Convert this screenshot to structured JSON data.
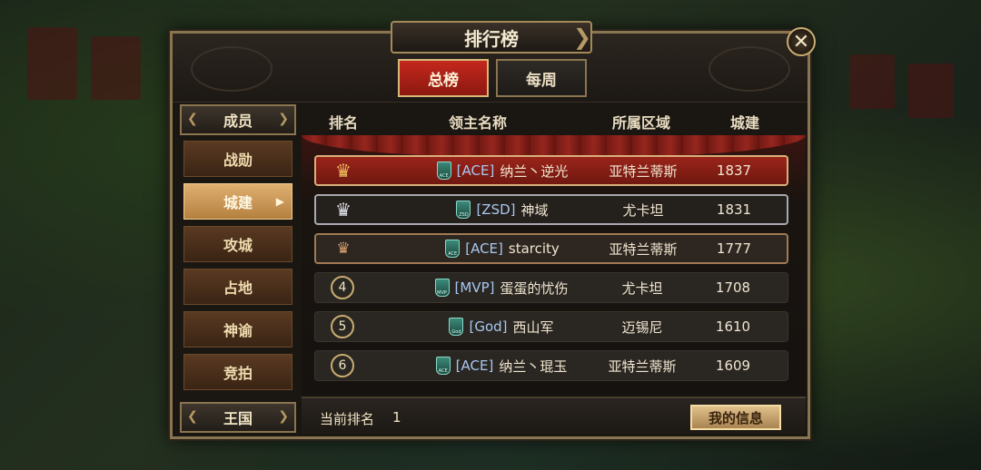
{
  "dialog": {
    "title": "排行榜",
    "close_symbol": "✕"
  },
  "tabs": [
    {
      "label": "总榜",
      "active": true
    },
    {
      "label": "每周",
      "active": false
    }
  ],
  "sidebar": {
    "header_top": "成员",
    "header_bottom": "王国",
    "items": [
      {
        "label": "战勋",
        "active": false
      },
      {
        "label": "城建",
        "active": true
      },
      {
        "label": "攻城",
        "active": false
      },
      {
        "label": "占地",
        "active": false
      },
      {
        "label": "神谕",
        "active": false
      },
      {
        "label": "竞拍",
        "active": false
      }
    ]
  },
  "table": {
    "columns": [
      "排名",
      "领主名称",
      "所属区域",
      "城建"
    ],
    "rows": [
      {
        "rank": "1",
        "badge": "ACE",
        "tag": "[ACE]",
        "name": "纳兰丶逆光",
        "region": "亚特兰蒂斯",
        "score": "1837"
      },
      {
        "rank": "2",
        "badge": "ZSD",
        "tag": "[ZSD]",
        "name": "神域",
        "region": "尤卡坦",
        "score": "1831"
      },
      {
        "rank": "3",
        "badge": "ACE",
        "tag": "[ACE]",
        "name": "starcity",
        "region": "亚特兰蒂斯",
        "score": "1777"
      },
      {
        "rank": "4",
        "badge": "MVP",
        "tag": "[MVP]",
        "name": "蛋蛋的忧伤",
        "region": "尤卡坦",
        "score": "1708"
      },
      {
        "rank": "5",
        "badge": "God",
        "tag": "[God]",
        "name": "西山军",
        "region": "迈锡尼",
        "score": "1610"
      },
      {
        "rank": "6",
        "badge": "ACE",
        "tag": "[ACE]",
        "name": "纳兰丶琨玉",
        "region": "亚特兰蒂斯",
        "score": "1609"
      }
    ]
  },
  "footer": {
    "current_rank_label": "当前排名",
    "current_rank_value": "1",
    "my_info_button": "我的信息"
  },
  "colors": {
    "active_tab": "#c4281c",
    "active_side": "#e0b070",
    "frame_gold": "#8a7550"
  }
}
